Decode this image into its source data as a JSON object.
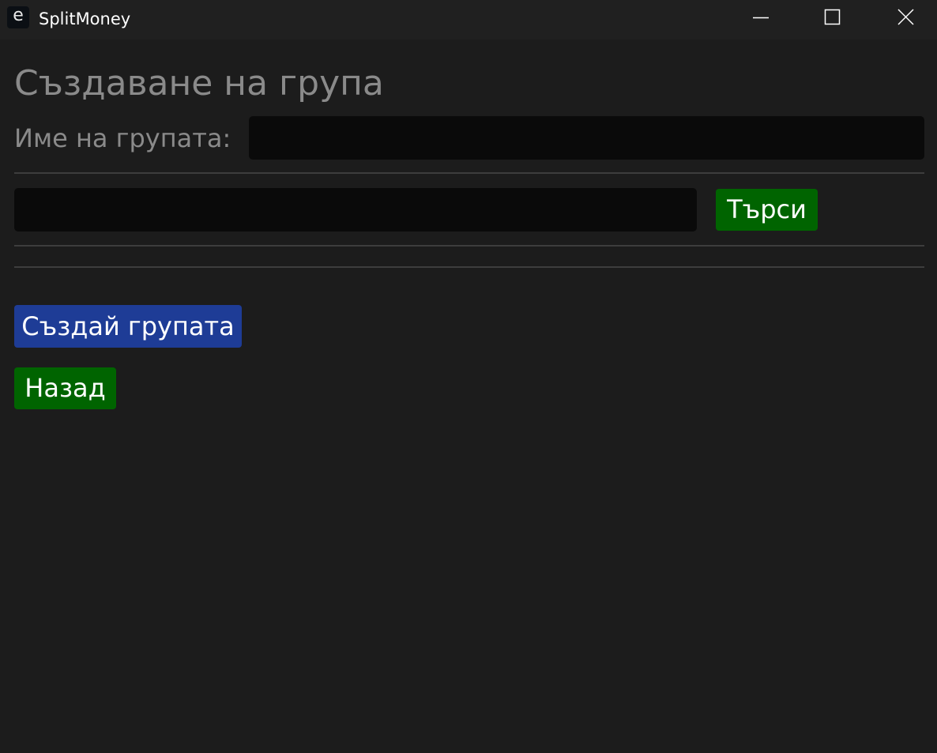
{
  "window": {
    "app_icon_glyph": "e",
    "title": "SplitMoney",
    "controls": {
      "minimize_icon": "minimize-icon",
      "maximize_icon": "maximize-icon",
      "close_icon": "close-icon"
    }
  },
  "page": {
    "heading": "Създаване на група",
    "group_name_label": "Име на групата:",
    "group_name_value": "",
    "search_value": "",
    "search_button": "Търси",
    "create_button": "Създай групата",
    "back_button": "Назад"
  },
  "colors": {
    "background": "#1c1c1c",
    "titlebar": "#202020",
    "input_background": "#0a0a0a",
    "muted_text": "#8a8a8a",
    "green_button": "#006400",
    "blue_button": "#1e3c96",
    "divider": "#3d3d3d"
  }
}
